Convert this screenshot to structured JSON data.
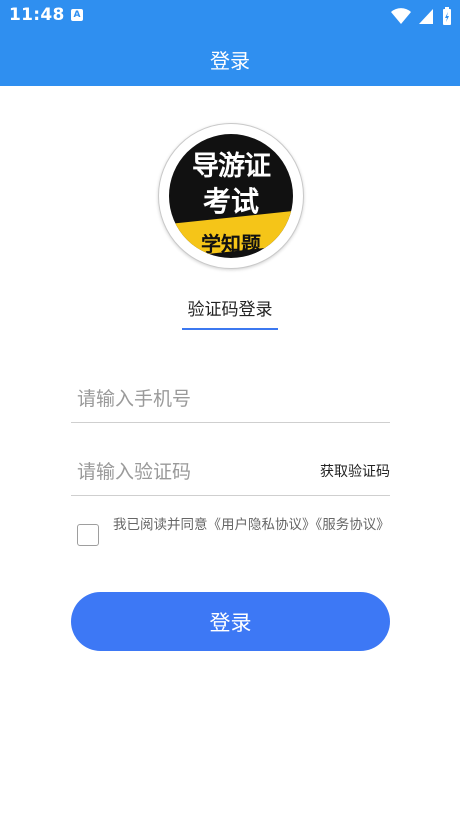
{
  "status_bar": {
    "time": "11:48",
    "notification_badge": "A",
    "icons": [
      "wifi-icon",
      "signal-icon",
      "battery-charging-icon"
    ]
  },
  "app_bar": {
    "title": "登录",
    "background_color": "#2f8ff0"
  },
  "logo": {
    "line1": "导游证",
    "line2": "考试",
    "line3": "学知题",
    "accent_color": "#f5c518"
  },
  "login_tab": {
    "label": "验证码登录",
    "underline_color": "#3c78f0"
  },
  "form": {
    "phone_placeholder": "请输入手机号",
    "phone_value": "",
    "code_placeholder": "请输入验证码",
    "code_value": "",
    "get_code_label": "获取验证码"
  },
  "agreement": {
    "checked": false,
    "text": "我已阅读并同意《用户隐私协议》《服务协议》"
  },
  "submit": {
    "label": "登录",
    "color": "#3d78f5"
  }
}
